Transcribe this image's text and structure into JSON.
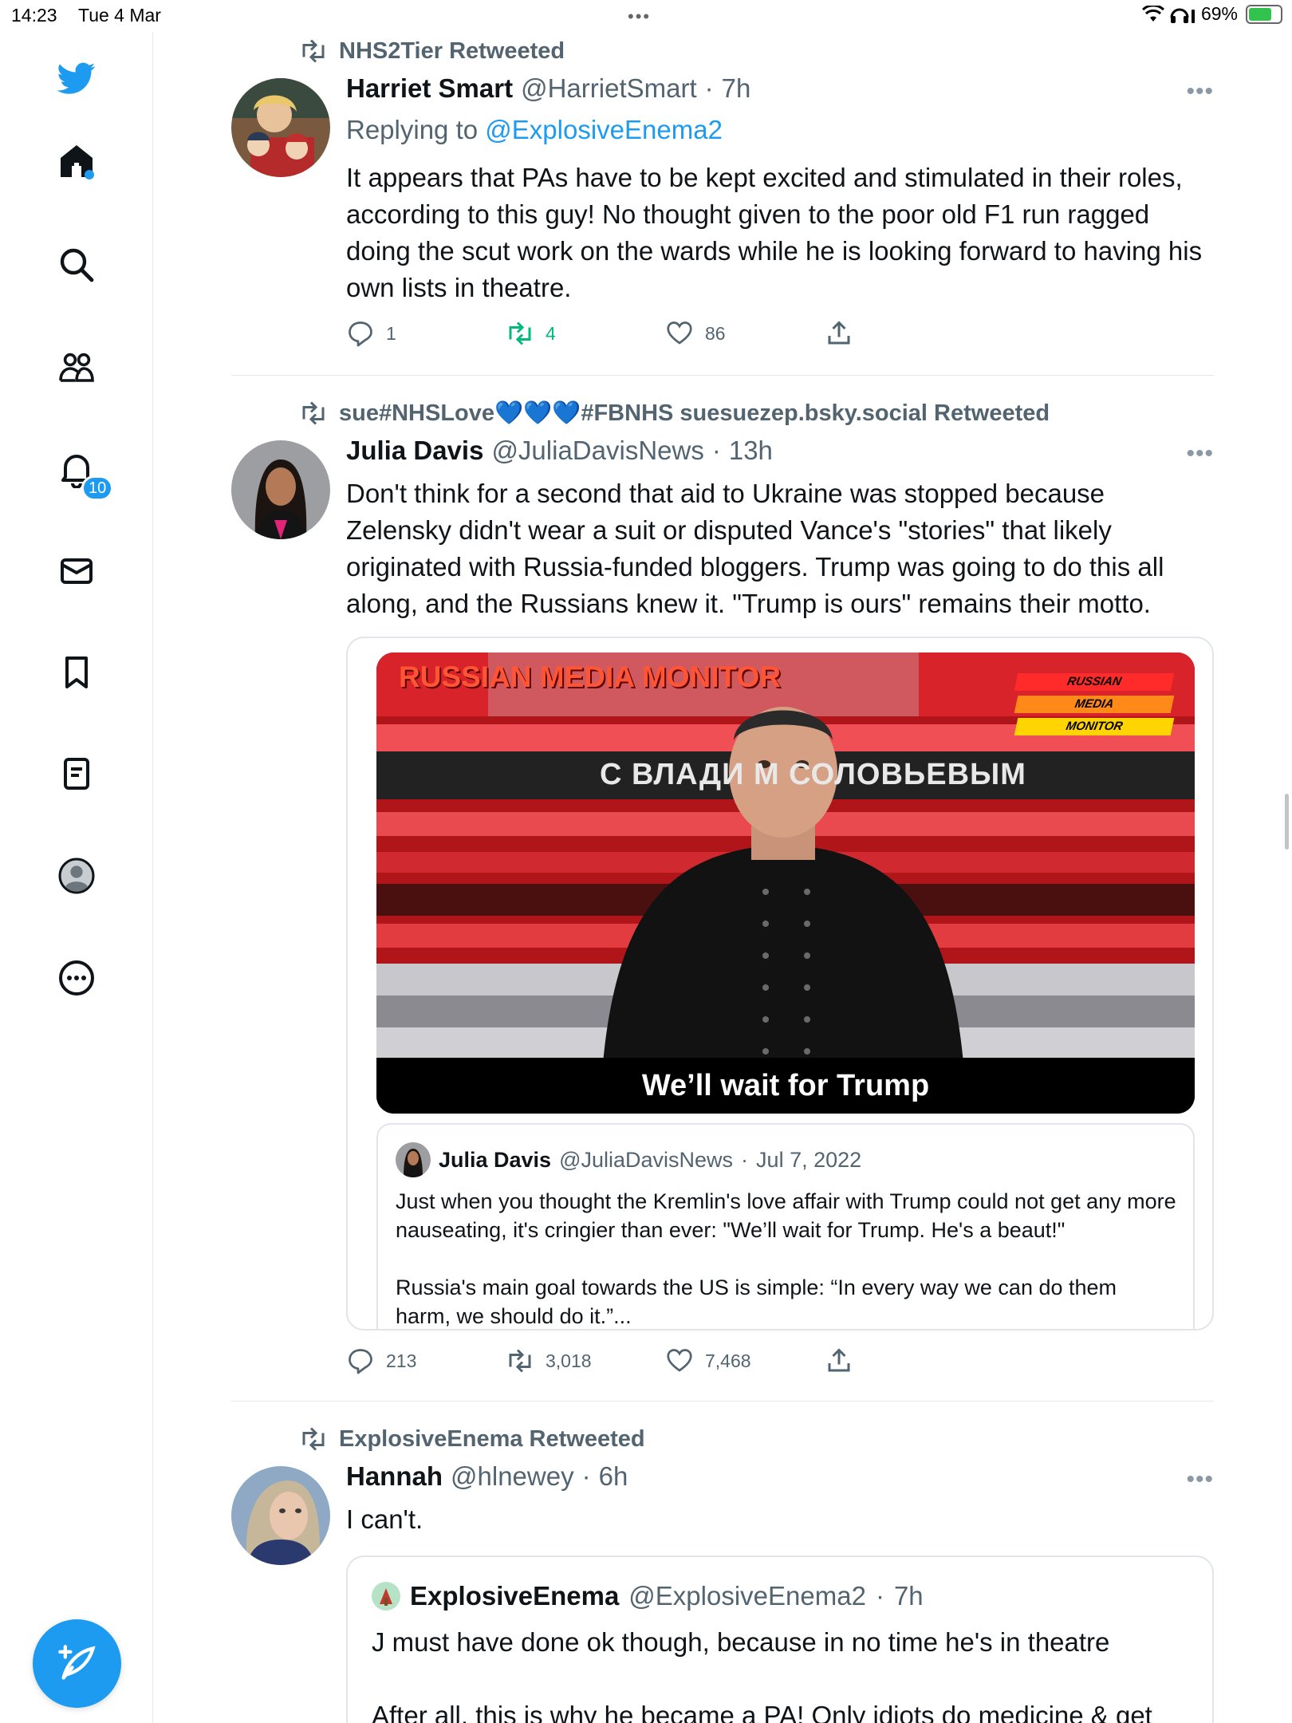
{
  "status_bar": {
    "time": "14:23",
    "date": "Tue 4 Mar",
    "battery": "69%",
    "battery_level": 0.69
  },
  "sidebar": {
    "items": [
      {
        "icon": "twitter-bird-icon"
      },
      {
        "icon": "home-icon"
      },
      {
        "icon": "search-icon"
      },
      {
        "icon": "communities-icon"
      },
      {
        "icon": "notifications-icon",
        "badge": "10"
      },
      {
        "icon": "messages-icon"
      },
      {
        "icon": "bookmarks-icon"
      },
      {
        "icon": "lists-icon"
      },
      {
        "icon": "profile-icon"
      },
      {
        "icon": "more-icon"
      }
    ],
    "compose_icon": "compose-quill-icon"
  },
  "tweets": [
    {
      "retweeted_by": "NHS2Tier Retweeted",
      "name": "Harriet Smart",
      "handle": "@HarrietSmart",
      "sep": "·",
      "time": "7h",
      "replying_label": "Replying to",
      "replying_to": "@ExplosiveEnema2",
      "text": "It appears that PAs have  to be kept excited and stimulated in their roles, according to this guy! No thought given to the poor old F1 run ragged doing the scut work on the wards while he is looking forward to having his own lists in theatre.",
      "replies": "1",
      "retweets": "4",
      "likes": "86"
    },
    {
      "retweeted_by": "sue#NHSLove💙💙💙#FBNHS suesuezep.bsky.social Retweeted",
      "name": "Julia Davis",
      "handle": "@JuliaDavisNews",
      "sep": "·",
      "time": "13h",
      "text": "Don't think for a second that aid to Ukraine was stopped because Zelensky didn't wear a suit or disputed Vance's \"stories\" that likely originated with Russia-funded bloggers. Trump was going to do this all along, and the Russians knew it. \"Trump is ours\" remains their motto.",
      "video": {
        "overlay_title": "RUSSIAN MEDIA MONITOR",
        "banner": "С ВЛАДИ     М СОЛОВЬЕВЫМ",
        "caption": "We’ll wait for Trump",
        "logo": [
          "RUSSIAN",
          "MEDIA",
          "MONITOR"
        ]
      },
      "quoted": {
        "name": "Julia Davis",
        "handle": "@JuliaDavisNews",
        "sep": "·",
        "date": "Jul 7, 2022",
        "text1": "Just when you thought the Kremlin's love affair with Trump could not get any more nauseating, it's cringier than ever: \"We’ll wait for Trump. He's a beaut!\"",
        "text2": "Russia's main goal towards the US is simple: “In every way we can do them harm, we should do it.”..."
      },
      "replies": "213",
      "retweets": "3,018",
      "likes": "7,468"
    },
    {
      "retweeted_by": "ExplosiveEnema Retweeted",
      "name": "Hannah",
      "handle": "@hlnewey",
      "sep": "·",
      "time": "6h",
      "text": "I can't.",
      "quoted": {
        "name": "ExplosiveEnema",
        "handle": "@ExplosiveEnema2",
        "sep": "·",
        "time": "7h",
        "text1": "J must have done ok though, because in no time he's in theatre",
        "text2": "After all, this is why he became a PA! Only idiots do medicine & get"
      }
    }
  ],
  "more_glyph": "•••",
  "colors": {
    "accent": "#1d9bf0",
    "muted": "#536471",
    "retweet_green": "#00ba7c",
    "text": "#0f1419"
  }
}
